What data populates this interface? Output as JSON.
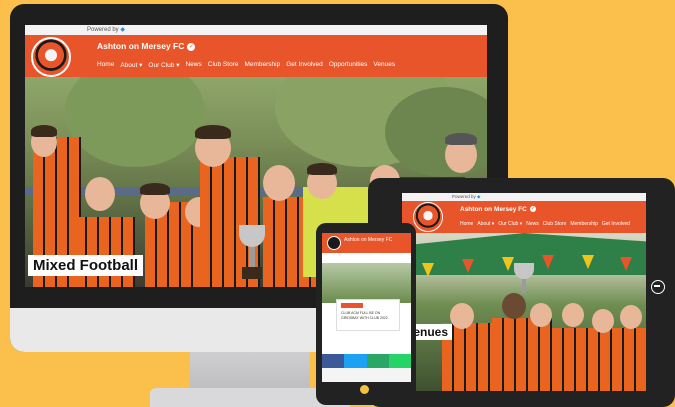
{
  "desktop": {
    "powered_by": "Powered by",
    "club_name": "Ashton on Mersey FC",
    "verified_mark": "✓",
    "nav": [
      {
        "label": "Home"
      },
      {
        "label": "About ▾"
      },
      {
        "label": "Our Club ▾"
      },
      {
        "label": "News"
      },
      {
        "label": "Club Store"
      },
      {
        "label": "Membership"
      },
      {
        "label": "Get Involved"
      },
      {
        "label": "Opportunities"
      },
      {
        "label": "Venues"
      }
    ],
    "hero_caption": "Mixed Football"
  },
  "tablet": {
    "powered_by": "Powered by",
    "club_name": "Ashton on Mersey FC",
    "verified_mark": "✓",
    "nav": [
      {
        "label": "Home"
      },
      {
        "label": "About ▾"
      },
      {
        "label": "Our Club ▾"
      },
      {
        "label": "News"
      },
      {
        "label": "Club Store"
      },
      {
        "label": "Membership"
      },
      {
        "label": "Get Involved"
      }
    ],
    "hero_caption": "Venues"
  },
  "phone": {
    "club_name": "Ashton on Mersey FC",
    "card_text": "CLUB ACM FULL BE ON GRIDSBAY WITH CLUB 2022"
  },
  "colors": {
    "background": "#fbc04c",
    "brand_orange": "#e8552a"
  }
}
